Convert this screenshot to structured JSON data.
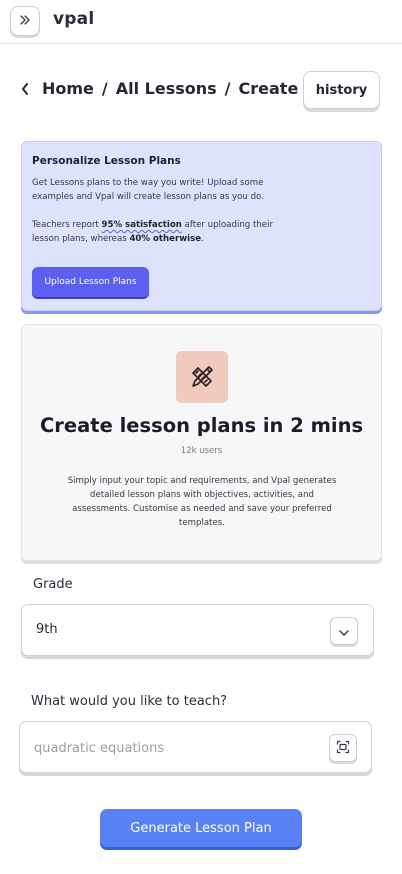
{
  "app": {
    "title": "vpal"
  },
  "breadcrumb": {
    "items": [
      "Home",
      "All Lessons",
      "Create"
    ],
    "separator": "/"
  },
  "header": {
    "history_label": "history"
  },
  "personalize": {
    "title": "Personalize Lesson Plans",
    "body": "Get Lessons plans to the way you write! Upload some examples and Vpal will create lesson plans as you do.",
    "stat_prefix": "Teachers report ",
    "stat_highlight": "95% satisfaction",
    "stat_middle": " after uploading their lesson plans, whereas ",
    "stat_other": "40% otherwise",
    "stat_suffix": ".",
    "upload_label": "Upload Lesson Plans"
  },
  "hero": {
    "title": "Create lesson plans in 2 mins",
    "users": "12k users",
    "description": "Simply input your topic and requirements, and Vpal generates detailed lesson plans with objectives, activities, and assessments. Customise as needed and save your preferred templates."
  },
  "grade": {
    "label": "Grade",
    "value": "9th"
  },
  "topic": {
    "label": "What would you like to teach?",
    "value": "",
    "placeholder": "quadratic equations"
  },
  "actions": {
    "generate_label": "Generate Lesson Plan"
  },
  "icons": {
    "expand": "double-chevron-right-icon",
    "back": "chevron-left-icon",
    "hero": "pencil-ruler-icon",
    "select": "chevron-down-icon",
    "scan": "scan-icon"
  },
  "colors": {
    "accent": "#5d5ff0",
    "primary_button": "#5b82f4",
    "personalize_bg": "#dfe2fb",
    "hero_icon_bg": "#f0c9bf"
  }
}
